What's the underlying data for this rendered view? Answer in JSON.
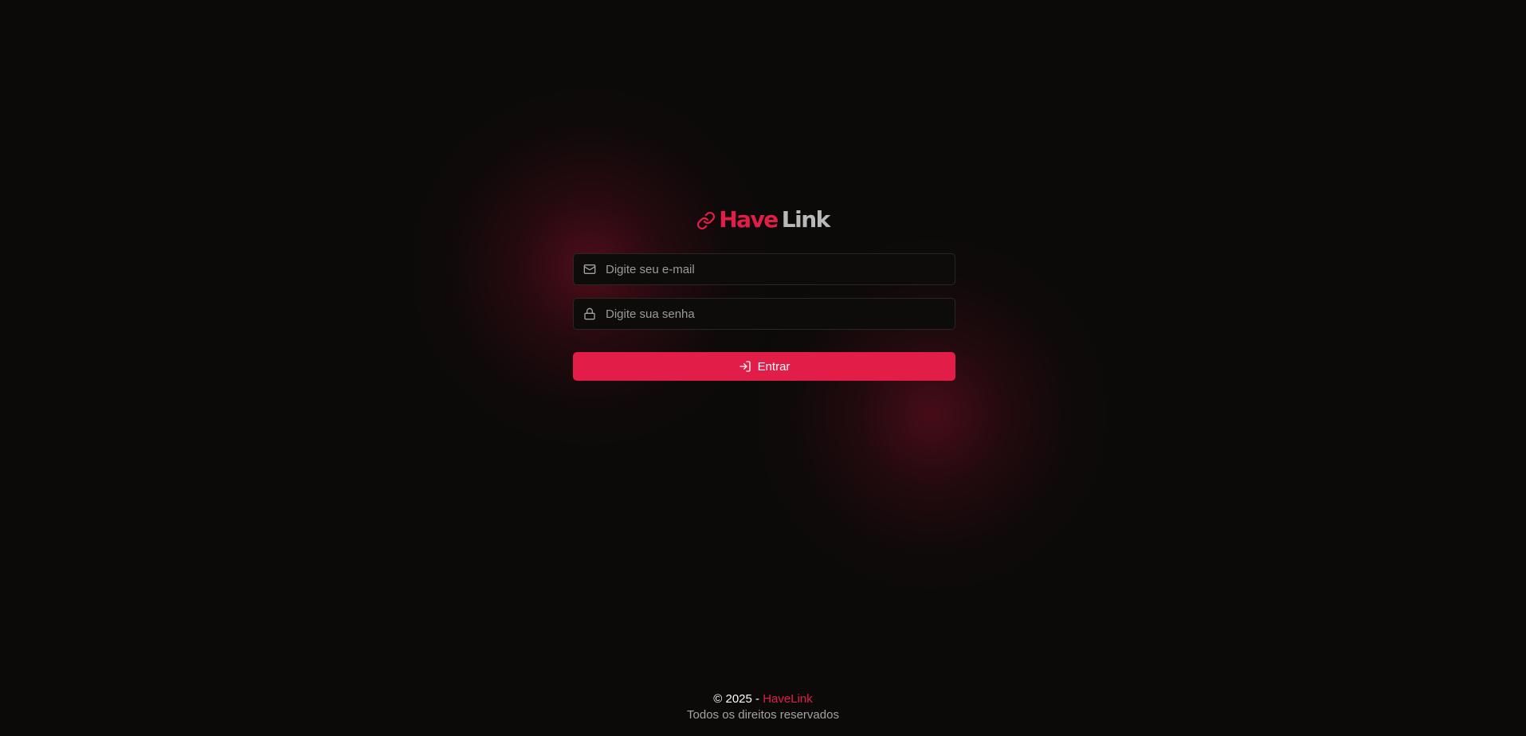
{
  "brand": {
    "logo_word_1": "Have",
    "logo_word_2": "Link",
    "icon": "link-icon",
    "accent_color": "#e11d48"
  },
  "form": {
    "email": {
      "placeholder": "Digite seu e-mail",
      "value": "",
      "icon": "mail-icon"
    },
    "password": {
      "placeholder": "Digite sua senha",
      "value": "",
      "icon": "lock-icon"
    },
    "submit": {
      "label": "Entrar",
      "icon": "log-in-icon"
    }
  },
  "footer": {
    "copyright_prefix": "© 2025 - ",
    "brand_name": "HaveLink",
    "rights": "Todos os direitos reservados"
  }
}
